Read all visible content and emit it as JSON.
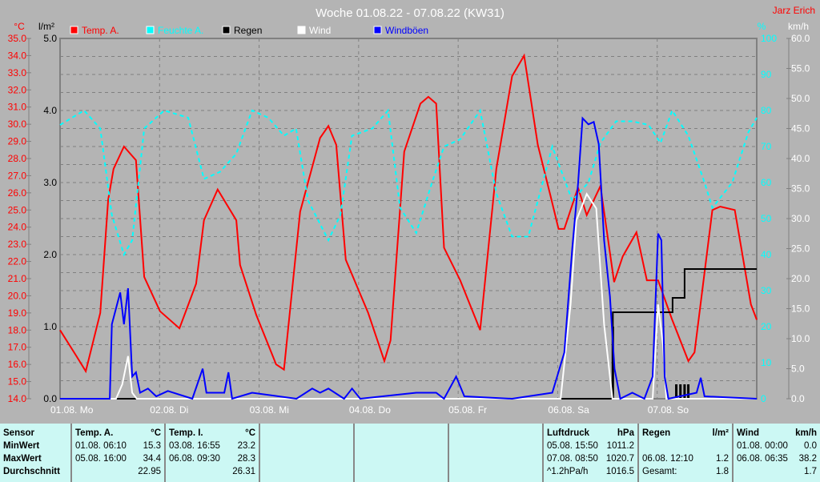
{
  "title": "Woche 01.08.22 - 07.08.22 (KW31)",
  "author": "Jarz Erich",
  "colors": {
    "temp": "#ff0000",
    "humidity": "#00ffff",
    "rain": "#000000",
    "wind": "#ffffff",
    "gust": "#0000ff"
  },
  "chart_data": {
    "type": "line",
    "title": "Woche 01.08.22 - 07.08.22 (KW31)",
    "x_unit": "hours since 01.08. 00:00",
    "xlim": [
      0,
      168
    ],
    "x_tick_labels": [
      "01.08. Mo",
      "02.08. Di",
      "03.08. Mi",
      "04.08. Do",
      "05.08. Fr",
      "06.08. Sa",
      "07.08. So"
    ],
    "axes": {
      "temp": {
        "label": "°C",
        "ylim": [
          14,
          35
        ],
        "step": 1
      },
      "rain": {
        "label": "l/m²",
        "ylim": [
          0,
          5
        ],
        "step": 1
      },
      "humidity": {
        "label": "%",
        "ylim": [
          0,
          100
        ],
        "step": 10
      },
      "wind": {
        "label": "km/h",
        "ylim": [
          0,
          60
        ],
        "step": 5
      }
    },
    "legend": [
      "Temp. A.",
      "Feuchte A.",
      "Regen",
      "Wind",
      "Windböen"
    ],
    "series": [
      {
        "name": "Temp. A.",
        "axis": "temp",
        "color": "#ff0000",
        "points": [
          [
            0,
            18.0
          ],
          [
            3.9,
            16.5
          ],
          [
            6.2,
            15.6
          ],
          [
            9.7,
            19.0
          ],
          [
            11.6,
            25.6
          ],
          [
            12.9,
            27.4
          ],
          [
            15.4,
            28.7
          ],
          [
            18.3,
            27.9
          ],
          [
            20.3,
            21.1
          ],
          [
            24.1,
            19.1
          ],
          [
            28.8,
            18.1
          ],
          [
            32.8,
            20.7
          ],
          [
            34.7,
            24.4
          ],
          [
            38.0,
            26.2
          ],
          [
            42.5,
            24.4
          ],
          [
            43.4,
            21.8
          ],
          [
            47.3,
            18.9
          ],
          [
            52.1,
            16.0
          ],
          [
            54.0,
            15.7
          ],
          [
            57.9,
            24.9
          ],
          [
            62.7,
            29.2
          ],
          [
            64.7,
            29.9
          ],
          [
            66.6,
            28.8
          ],
          [
            68.9,
            22.1
          ],
          [
            74.3,
            19.0
          ],
          [
            78.2,
            16.2
          ],
          [
            79.7,
            17.4
          ],
          [
            83.0,
            28.4
          ],
          [
            86.9,
            31.2
          ],
          [
            88.8,
            31.6
          ],
          [
            90.7,
            31.2
          ],
          [
            92.6,
            22.8
          ],
          [
            96.5,
            20.9
          ],
          [
            101.3,
            18.0
          ],
          [
            105.2,
            27.4
          ],
          [
            109.0,
            32.8
          ],
          [
            111.9,
            34.0
          ],
          [
            115.2,
            28.8
          ],
          [
            118.3,
            25.8
          ],
          [
            120.2,
            23.9
          ],
          [
            121.6,
            23.9
          ],
          [
            124.9,
            26.3
          ],
          [
            127.0,
            24.7
          ],
          [
            130.3,
            26.4
          ],
          [
            133.6,
            20.8
          ],
          [
            135.7,
            22.3
          ],
          [
            139.0,
            23.7
          ],
          [
            141.5,
            20.9
          ],
          [
            144.2,
            20.9
          ],
          [
            147.6,
            18.6
          ],
          [
            151.5,
            16.2
          ],
          [
            153.0,
            16.7
          ],
          [
            157.3,
            25.0
          ],
          [
            159.2,
            25.2
          ],
          [
            162.7,
            25.0
          ],
          [
            166.6,
            19.5
          ],
          [
            168,
            18.6
          ]
        ]
      },
      {
        "name": "Feuchte A.",
        "axis": "humidity",
        "color": "#00ffff",
        "dashed": true,
        "points": [
          [
            0,
            76
          ],
          [
            5.8,
            80
          ],
          [
            9.7,
            75
          ],
          [
            12.5,
            51
          ],
          [
            15.4,
            40
          ],
          [
            17.4,
            44
          ],
          [
            20.3,
            75
          ],
          [
            25.1,
            80
          ],
          [
            30.9,
            78
          ],
          [
            34.7,
            61
          ],
          [
            38.6,
            63
          ],
          [
            42.5,
            68
          ],
          [
            46.3,
            80
          ],
          [
            50.2,
            78
          ],
          [
            54.0,
            73
          ],
          [
            56.9,
            75
          ],
          [
            59.8,
            55
          ],
          [
            64.7,
            44
          ],
          [
            67.6,
            51
          ],
          [
            70.4,
            73
          ],
          [
            75.3,
            75
          ],
          [
            79.1,
            80
          ],
          [
            82.0,
            53
          ],
          [
            85.9,
            46
          ],
          [
            89.7,
            60
          ],
          [
            92.6,
            70
          ],
          [
            96.5,
            72
          ],
          [
            101.3,
            80
          ],
          [
            105.2,
            57
          ],
          [
            109.0,
            45
          ],
          [
            112.9,
            45
          ],
          [
            118.7,
            70
          ],
          [
            123.5,
            55
          ],
          [
            127.4,
            60
          ],
          [
            130.3,
            71
          ],
          [
            134.1,
            77
          ],
          [
            138.0,
            77
          ],
          [
            141.9,
            76
          ],
          [
            144.8,
            71
          ],
          [
            147.6,
            80
          ],
          [
            151.5,
            73
          ],
          [
            155.4,
            60
          ],
          [
            157.3,
            53
          ],
          [
            162.1,
            60
          ],
          [
            166.0,
            74
          ],
          [
            168,
            78
          ]
        ]
      },
      {
        "name": "Regen",
        "axis": "rain",
        "color": "#000000",
        "step": true,
        "points": [
          [
            0,
            0
          ],
          [
            133.3,
            0
          ],
          [
            133.3,
            1.2
          ],
          [
            147.7,
            1.2
          ],
          [
            147.7,
            1.4
          ],
          [
            150.6,
            1.4
          ],
          [
            150.6,
            1.8
          ],
          [
            168,
            1.8
          ]
        ]
      },
      {
        "name": "Regen Intervall",
        "axis": "rain",
        "color": "#000000",
        "bars": true,
        "points": [
          [
            133.3,
            1.0
          ],
          [
            148.6,
            0.2
          ],
          [
            149.6,
            0.2
          ],
          [
            150.6,
            0.2
          ],
          [
            151.5,
            0.2
          ]
        ]
      },
      {
        "name": "Wind",
        "axis": "wind",
        "color": "#ffffff",
        "points": [
          [
            0,
            0
          ],
          [
            13.5,
            0
          ],
          [
            15,
            2.4
          ],
          [
            16.4,
            7.1
          ],
          [
            17.4,
            1
          ],
          [
            18.5,
            0
          ],
          [
            120.7,
            0
          ],
          [
            123.1,
            15.7
          ],
          [
            124.5,
            29.7
          ],
          [
            127,
            34.1
          ],
          [
            129.3,
            31.7
          ],
          [
            131.2,
            12.4
          ],
          [
            133.2,
            0
          ],
          [
            142.9,
            0
          ],
          [
            144.2,
            15.7
          ],
          [
            145.4,
            9
          ],
          [
            146.2,
            0
          ],
          [
            168,
            0
          ]
        ]
      },
      {
        "name": "Windböen",
        "axis": "wind",
        "color": "#0000ff",
        "points": [
          [
            0,
            0
          ],
          [
            12,
            0
          ],
          [
            12.5,
            12.4
          ],
          [
            14.5,
            17.7
          ],
          [
            15.4,
            12.4
          ],
          [
            16.4,
            18.4
          ],
          [
            17.4,
            3.7
          ],
          [
            18.3,
            4.4
          ],
          [
            19.3,
            1
          ],
          [
            21.2,
            1.7
          ],
          [
            23.2,
            0.4
          ],
          [
            26,
            1.3
          ],
          [
            31.9,
            0
          ],
          [
            34.4,
            5
          ],
          [
            35.3,
            1
          ],
          [
            39.6,
            1
          ],
          [
            40.6,
            4.4
          ],
          [
            41.5,
            0
          ],
          [
            46.3,
            1
          ],
          [
            57,
            0
          ],
          [
            60.8,
            1.7
          ],
          [
            62.7,
            1
          ],
          [
            64.7,
            1.7
          ],
          [
            68.5,
            0
          ],
          [
            70.4,
            1.7
          ],
          [
            72.4,
            0
          ],
          [
            85.9,
            1
          ],
          [
            90.7,
            1
          ],
          [
            92.6,
            0
          ],
          [
            95.5,
            3.7
          ],
          [
            97.5,
            0.4
          ],
          [
            109,
            0
          ],
          [
            118.7,
            1
          ],
          [
            121.6,
            7.7
          ],
          [
            123.5,
            25
          ],
          [
            124.9,
            35.7
          ],
          [
            126,
            46.7
          ],
          [
            127.4,
            45.7
          ],
          [
            128.7,
            46.1
          ],
          [
            129.9,
            42.4
          ],
          [
            131.2,
            26.4
          ],
          [
            132.6,
            17
          ],
          [
            133.7,
            5
          ],
          [
            135.1,
            0
          ],
          [
            138,
            1
          ],
          [
            140.9,
            0
          ],
          [
            142.9,
            3.7
          ],
          [
            144.2,
            27.5
          ],
          [
            145,
            26.4
          ],
          [
            145.8,
            3.7
          ],
          [
            146.7,
            0
          ],
          [
            153.5,
            1
          ],
          [
            154.5,
            3.5
          ],
          [
            155.4,
            0.4
          ],
          [
            168,
            0
          ]
        ]
      }
    ]
  },
  "table": {
    "sensor": {
      "header": "Sensor",
      "rows": [
        "MinWert",
        "MaxWert",
        "Durchschnitt"
      ]
    },
    "temp_a": {
      "header": "Temp. A.",
      "unit": "°C",
      "min_time": "01.08.  06:10",
      "min": "15.3",
      "max_time": "05.08.  16:00",
      "max": "34.4",
      "avg": "22.95"
    },
    "temp_i": {
      "header": "Temp. I.",
      "unit": "°C",
      "min_time": "03.08.  16:55",
      "min": "23.2",
      "max_time": "06.08.  09:30",
      "max": "28.3",
      "avg": "26.31"
    },
    "pressure": {
      "header": "Luftdruck",
      "unit": "hPa",
      "min_time": "05.08.  15:50",
      "min": "1011.2",
      "max_time": "07.08.  08:50",
      "max": "1020.7",
      "trend": "^1.2hPa/h",
      "avg": "1016.5"
    },
    "rain": {
      "header": "Regen",
      "unit": "l/m²",
      "max_time": "06.08.  12:10",
      "max": "1.2",
      "total_label": "Gesamt:",
      "total": "1.8"
    },
    "wind": {
      "header": "Wind",
      "unit": "km/h",
      "min_time": "01.08.  00:00",
      "min": "0.0",
      "max_time": "06.08.  06:35",
      "max": "38.2",
      "avg": "1.7"
    }
  }
}
